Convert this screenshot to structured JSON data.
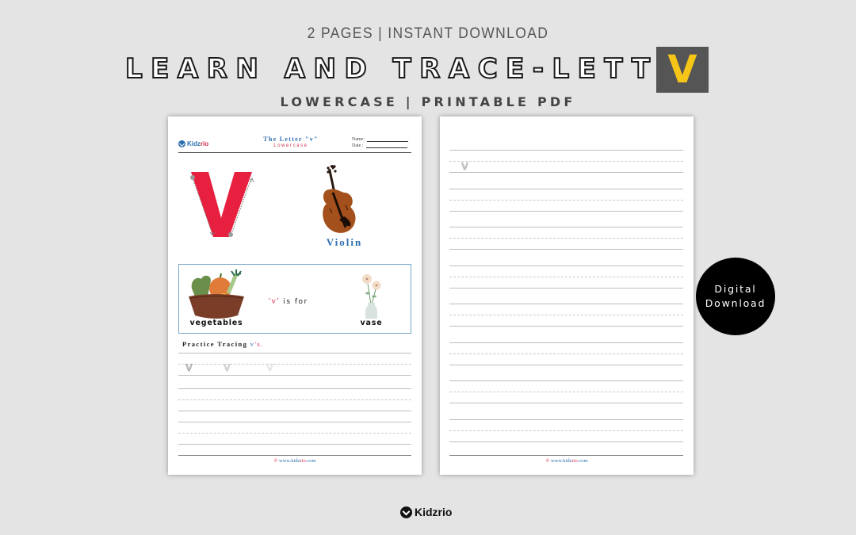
{
  "header": {
    "subtitle_top": "2 PAGES | INSTANT DOWNLOAD",
    "title": "LEARN AND TRACE-LETTER",
    "title_letter": "V",
    "subtitle_bottom": "LOWERCASE | PRINTABLE PDF"
  },
  "colors": {
    "background": "#e4e4e4",
    "letter_box": "#555555",
    "letter_accent": "#f5c518",
    "brand_blue": "#2c6fb0",
    "brand_red": "#d42a4a"
  },
  "page1": {
    "logo": {
      "kidz": "Kidz",
      "rio": "rio",
      "icon": "kidzrio-logo-icon"
    },
    "title": "The Letter \"v\"",
    "subtitle": "Lowercase",
    "name_label": "Name:",
    "date_label": "Date :",
    "big_letter": "v",
    "object_label": "Violin",
    "example": {
      "left_word": "vegetables",
      "is_for_letter": "'v'",
      "is_for_text": " is for",
      "right_word": "vase"
    },
    "practice": {
      "prefix": "Practice Tracing ",
      "letter": "v",
      "suffix": "'s."
    },
    "trace_letters": [
      "v",
      "v",
      "v"
    ],
    "footer": {
      "symbol": "©",
      "pre": " www.kidz",
      "rio": "rio",
      "post": ".com"
    }
  },
  "page2": {
    "trace_letters": [
      "v"
    ],
    "footer": {
      "symbol": "©",
      "pre": " www.kidz",
      "rio": "rio",
      "post": ".com"
    }
  },
  "badge": {
    "line1": "Digital",
    "line2": "Download"
  },
  "brand": {
    "name": "Kidzrio",
    "icon": "kidzrio-logo-icon"
  }
}
